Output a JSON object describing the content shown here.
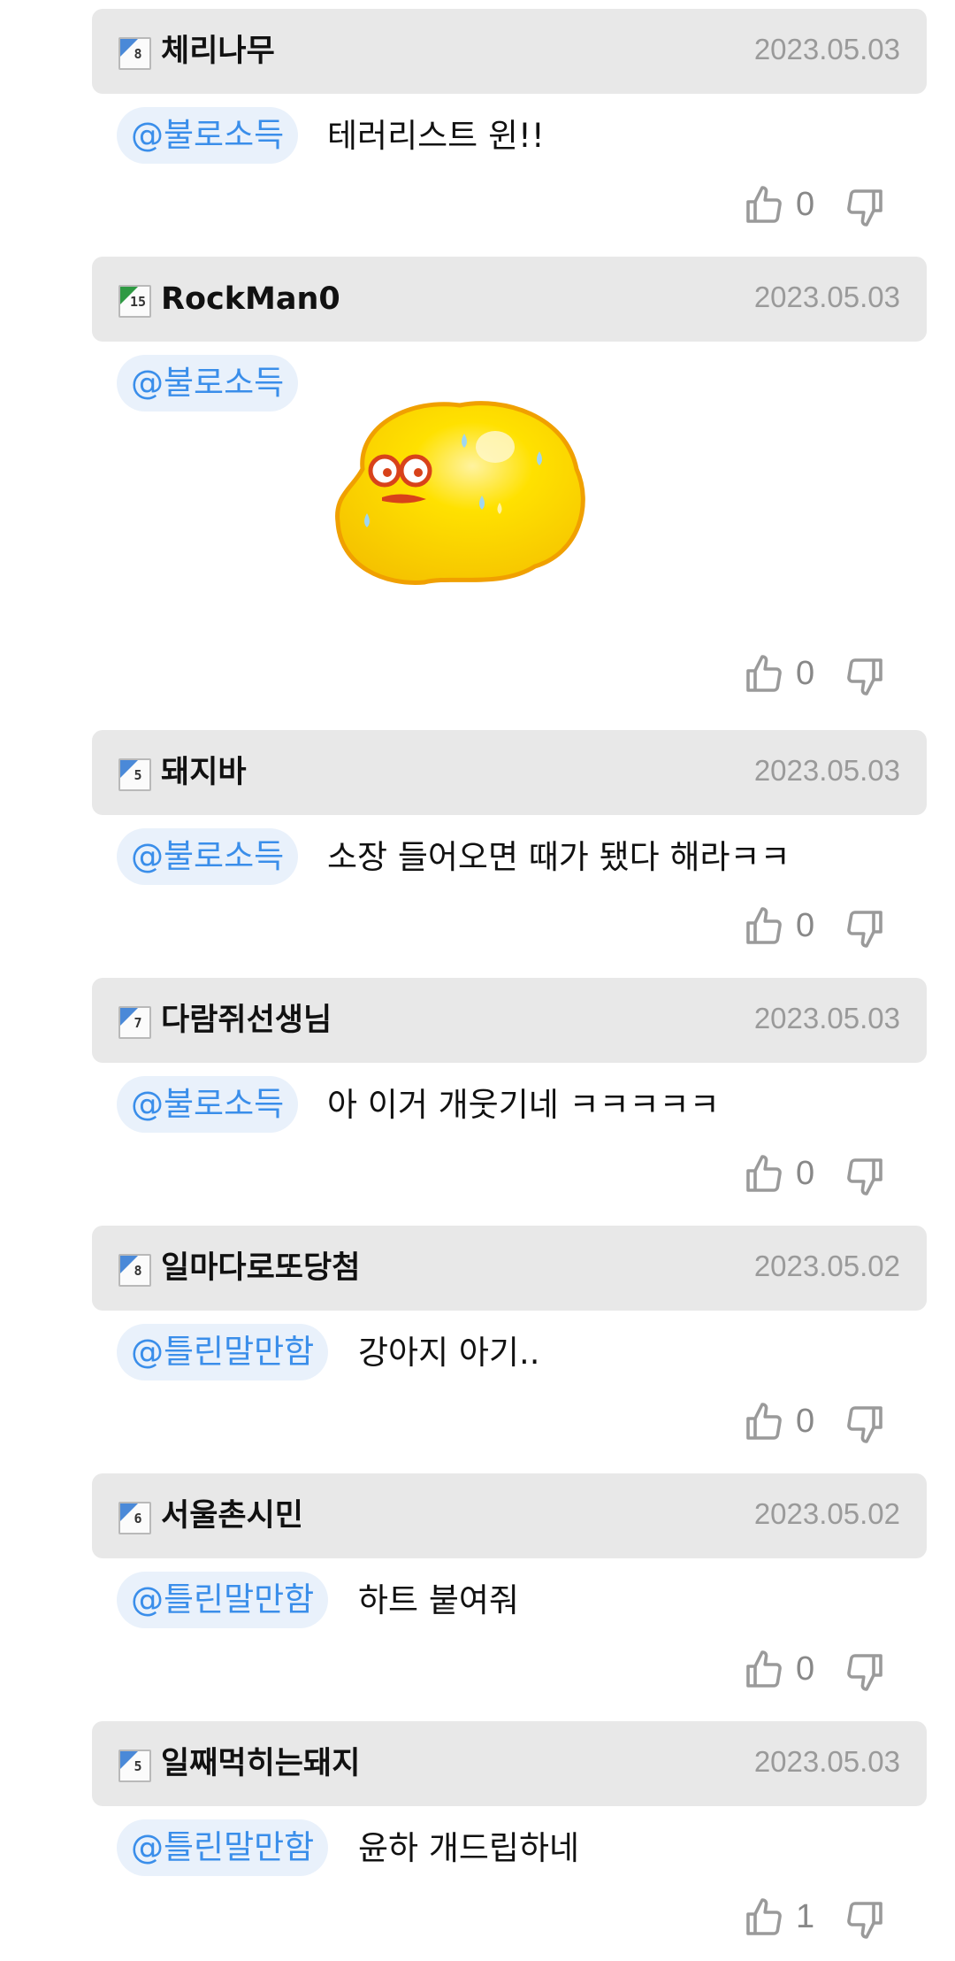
{
  "comments": [
    {
      "level": "8",
      "level_color": "#4a89d8",
      "username": "체리나무",
      "date": "2023.05.03",
      "mention": "@불로소득",
      "text": "테러리스트 윈!!",
      "likes": "0",
      "has_sticker": false
    },
    {
      "level": "15",
      "level_color": "#2e9a43",
      "username": "RockMan0",
      "date": "2023.05.03",
      "mention": "@불로소득",
      "text": "",
      "likes": "0",
      "has_sticker": true,
      "sticker_icon": "sweating-yellow-blob-sticker"
    },
    {
      "level": "5",
      "level_color": "#4a89d8",
      "username": "돼지바",
      "date": "2023.05.03",
      "mention": "@불로소득",
      "text": "소장 들어오면 때가 됐다 해라ㅋㅋ",
      "likes": "0",
      "has_sticker": false
    },
    {
      "level": "7",
      "level_color": "#4a89d8",
      "username": "다람쥐선생님",
      "date": "2023.05.03",
      "mention": "@불로소득",
      "text": "아 이거 개웃기네 ㅋㅋㅋㅋㅋ",
      "likes": "0",
      "has_sticker": false
    },
    {
      "level": "8",
      "level_color": "#4a89d8",
      "username": "일마다로또당첨",
      "date": "2023.05.02",
      "mention": "@틀린말만함",
      "text": "강아지 아기..",
      "likes": "0",
      "has_sticker": false
    },
    {
      "level": "6",
      "level_color": "#4a89d8",
      "username": "서울촌시민",
      "date": "2023.05.02",
      "mention": "@틀린말만함",
      "text": "하트 붙여줘",
      "likes": "0",
      "has_sticker": false
    },
    {
      "level": "5",
      "level_color": "#4a89d8",
      "username": "일째먹히는돼지",
      "date": "2023.05.03",
      "mention": "@틀린말만함",
      "text": "윤하 개드립하네",
      "likes": "1",
      "has_sticker": false
    }
  ],
  "icons": {
    "like": "thumbs-up-icon",
    "dislike": "thumbs-down-icon",
    "level_badge": "level-badge-icon"
  },
  "colors": {
    "header_bg": "#e8e8e8",
    "mention_text": "#3a8eea",
    "mention_bg": "#e9f1fb",
    "date_text": "#9a9a9a"
  }
}
